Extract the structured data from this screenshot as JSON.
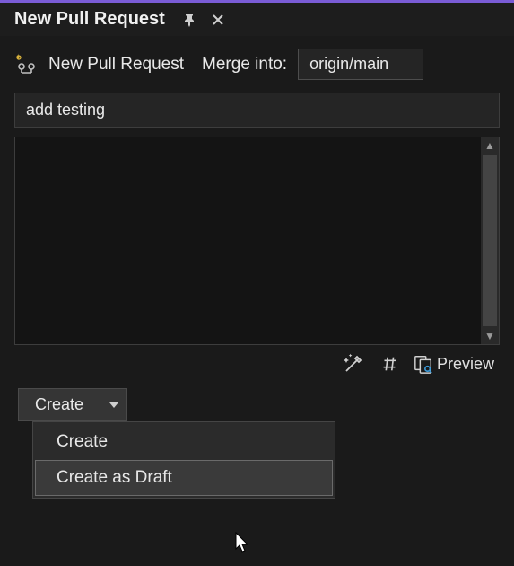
{
  "titlebar": {
    "title": "New Pull Request"
  },
  "header": {
    "label": "New Pull Request",
    "merge_label": "Merge into:",
    "branch": "origin/main"
  },
  "form": {
    "title_value": "add testing",
    "description_value": ""
  },
  "toolbar": {
    "preview_label": "Preview"
  },
  "split_button": {
    "label": "Create"
  },
  "dropdown": {
    "items": [
      {
        "label": "Create",
        "highlighted": false
      },
      {
        "label": "Create as Draft",
        "highlighted": true
      }
    ]
  }
}
